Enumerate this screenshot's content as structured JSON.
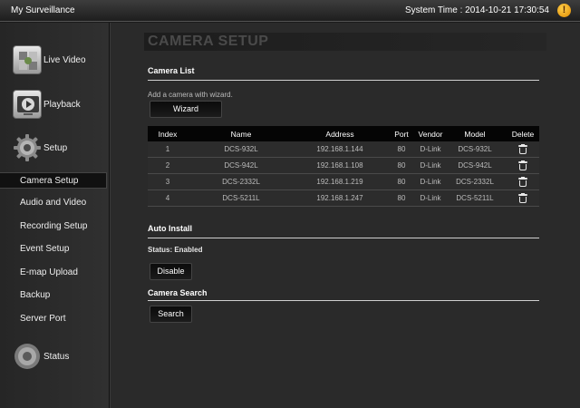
{
  "titlebar": {
    "app_title": "My Surveillance",
    "system_time": "System Time : 2014-10-21 17:30:54",
    "alert_glyph": "!"
  },
  "sidebar": {
    "live_video": "Live Video",
    "playback": "Playback",
    "setup": "Setup",
    "status": "Status",
    "setup_items": [
      {
        "label": "Camera Setup",
        "active": true
      },
      {
        "label": "Audio and Video"
      },
      {
        "label": "Recording Setup"
      },
      {
        "label": "Event Setup"
      },
      {
        "label": "E-map Upload"
      },
      {
        "label": "Backup"
      },
      {
        "label": "Server Port"
      }
    ]
  },
  "main": {
    "page_title": "CAMERA SETUP",
    "camera_list": {
      "heading": "Camera List",
      "hint": "Add a camera with wizard.",
      "wizard_label": "Wizard",
      "columns": [
        "Index",
        "Name",
        "Address",
        "Port",
        "Vendor",
        "Model",
        "Delete"
      ],
      "rows": [
        {
          "index": "1",
          "name": "DCS-932L",
          "address": "192.168.1.144",
          "port": "80",
          "vendor": "D-Link",
          "model": "DCS-932L"
        },
        {
          "index": "2",
          "name": "DCS-942L",
          "address": "192.168.1.108",
          "port": "80",
          "vendor": "D-Link",
          "model": "DCS-942L"
        },
        {
          "index": "3",
          "name": "DCS-2332L",
          "address": "192.168.1.219",
          "port": "80",
          "vendor": "D-Link",
          "model": "DCS-2332L"
        },
        {
          "index": "4",
          "name": "DCS-5211L",
          "address": "192.168.1.247",
          "port": "80",
          "vendor": "D-Link",
          "model": "DCS-5211L"
        }
      ]
    },
    "auto_install": {
      "heading": "Auto Install",
      "status": "Status: Enabled",
      "disable_label": "Disable"
    },
    "camera_search": {
      "heading": "Camera Search",
      "search_label": "Search"
    }
  },
  "colors": {
    "background": "#1a1a1a",
    "panel": "#2a2a2a",
    "accent_alert": "#f0a000"
  }
}
